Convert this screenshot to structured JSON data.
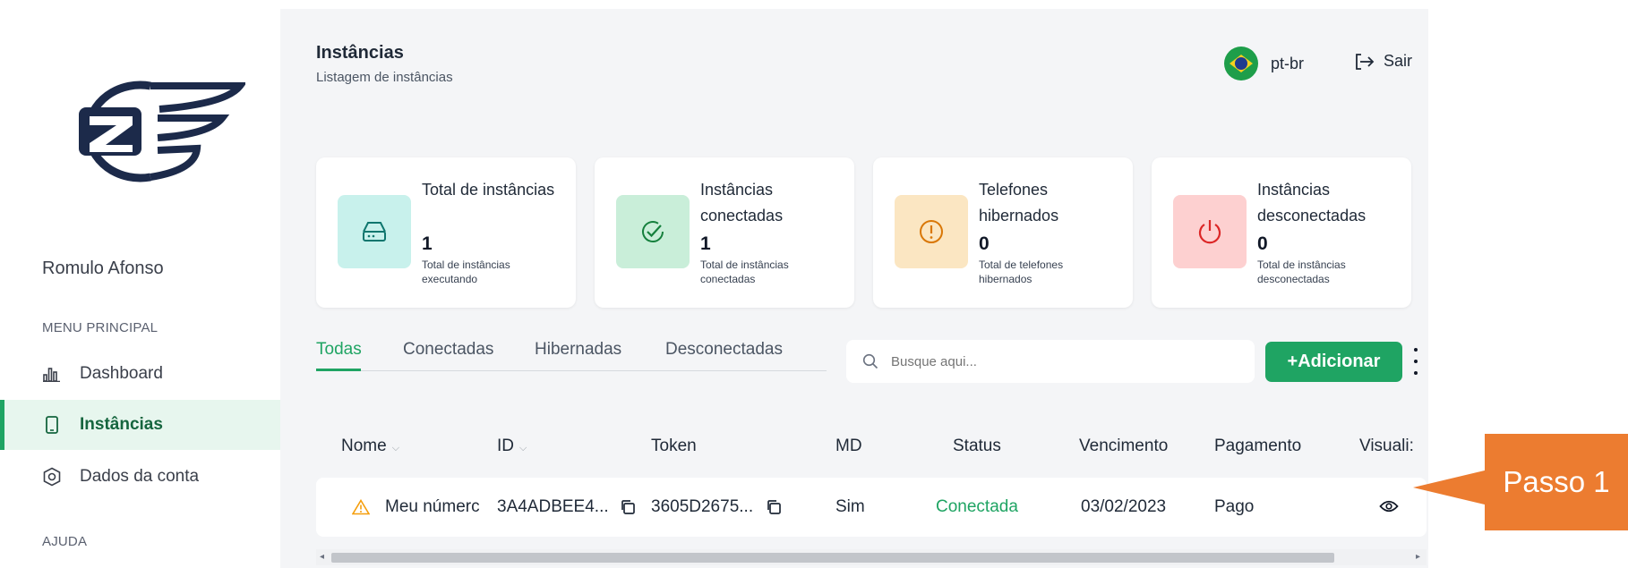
{
  "sidebar": {
    "user_name": "Romulo Afonso",
    "menu_heading": "MENU PRINCIPAL",
    "items": [
      {
        "label": "Dashboard",
        "icon": "bar-chart-icon",
        "active": false
      },
      {
        "label": "Instâncias",
        "icon": "phone-icon",
        "active": true
      },
      {
        "label": "Dados da conta",
        "icon": "settings-icon",
        "active": false
      }
    ],
    "help_heading": "AJUDA"
  },
  "header": {
    "title": "Instâncias",
    "subtitle": "Listagem de instâncias",
    "language": "pt-br",
    "language_icon": "brazil-flag-icon",
    "logout_label": "Sair",
    "logout_icon": "logout-icon"
  },
  "cards": [
    {
      "title": "Total de instâncias",
      "value": "1",
      "description": "Total de instâncias executando",
      "icon": "server-icon",
      "bg": "#c8f1ec",
      "fg": "#0f766e"
    },
    {
      "title": "Instâncias conectadas",
      "value": "1",
      "description": "Total de instâncias conectadas",
      "icon": "check-badge-icon",
      "bg": "#c9eed9",
      "fg": "#15803d"
    },
    {
      "title": "Telefones hibernados",
      "value": "0",
      "description": "Total de telefones hibernados",
      "icon": "alert-circle-icon",
      "bg": "#fbe6c2",
      "fg": "#d97706"
    },
    {
      "title": "Instâncias desconectadas",
      "value": "0",
      "description": "Total de instâncias desconectadas",
      "icon": "power-icon",
      "bg": "#fdd0d0",
      "fg": "#dc2626"
    }
  ],
  "tabs": [
    {
      "label": "Todas",
      "active": true
    },
    {
      "label": "Conectadas",
      "active": false
    },
    {
      "label": "Hibernadas",
      "active": false
    },
    {
      "label": "Desconectadas",
      "active": false
    }
  ],
  "search": {
    "placeholder": "Busque aqui..."
  },
  "add_button": {
    "label": "+Adicionar"
  },
  "table": {
    "columns": [
      "Nome",
      "ID",
      "Token",
      "MD",
      "Status",
      "Vencimento",
      "Pagamento",
      "Visuali:"
    ],
    "rows": [
      {
        "name": "Meu númerc",
        "id": "3A4ADBEE4...",
        "token": "3605D2675...",
        "md": "Sim",
        "status": "Conectada",
        "due": "03/02/2023",
        "payment": "Pago"
      }
    ]
  },
  "callout": {
    "label": "Passo 1"
  },
  "colors": {
    "accent": "#1fa463",
    "callout": "#ec7c30",
    "logo": "#1c2a4a"
  }
}
